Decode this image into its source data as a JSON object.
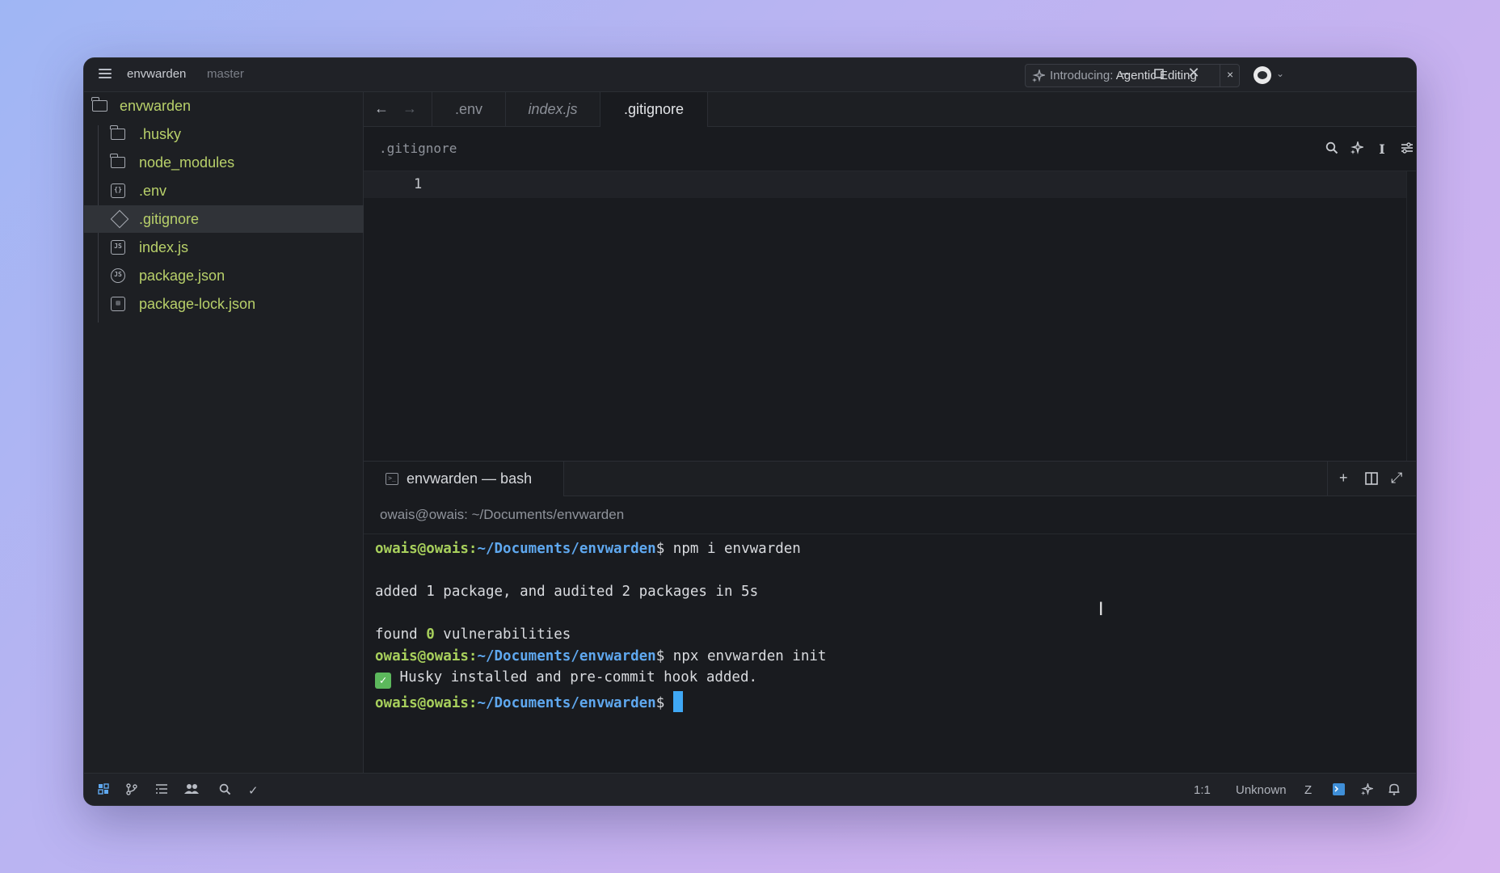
{
  "titlebar": {
    "project": "envwarden",
    "branch": "master",
    "announcement_prefix": "Introducing:",
    "announcement_title": "Agentic Editing",
    "close_glyph": "×"
  },
  "sidebar": {
    "root": "envwarden",
    "items": [
      {
        "label": ".husky",
        "icon": "folder-icon"
      },
      {
        "label": "node_modules",
        "icon": "folder-icon"
      },
      {
        "label": ".env",
        "icon": "env-file-icon"
      },
      {
        "label": ".gitignore",
        "icon": "git-diamond-icon",
        "selected": true
      },
      {
        "label": "index.js",
        "icon": "js-file-icon"
      },
      {
        "label": "package.json",
        "icon": "nodejs-icon"
      },
      {
        "label": "package-lock.json",
        "icon": "lock-file-icon"
      }
    ]
  },
  "tabs": [
    {
      "label": ".env"
    },
    {
      "label": "index.js"
    },
    {
      "label": ".gitignore",
      "active": true
    }
  ],
  "editor": {
    "breadcrumb": ".gitignore",
    "line_number": "1"
  },
  "terminal": {
    "tab_label": "envwarden — bash",
    "title": "owais@owais: ~/Documents/envwarden",
    "prompt_user": "owais@owais",
    "prompt_sep": ":",
    "prompt_path": "~/Documents/envwarden",
    "prompt_dollar": "$",
    "cmd1": " npm i envwarden",
    "out1": "added 1 package, and audited 2 packages in 5s",
    "out2_pre": "found ",
    "out2_num": "0",
    "out2_post": " vulnerabilities",
    "cmd2": " npx envwarden init",
    "check": "✓",
    "out3": " Husky installed and pre-commit hook added."
  },
  "statusbar": {
    "cursor_pos": "1:1",
    "language": "Unknown"
  },
  "colors": {
    "accent": "#5fa8ef",
    "prompt_green": "#a8d05c",
    "file_label": "#b8d06a"
  }
}
